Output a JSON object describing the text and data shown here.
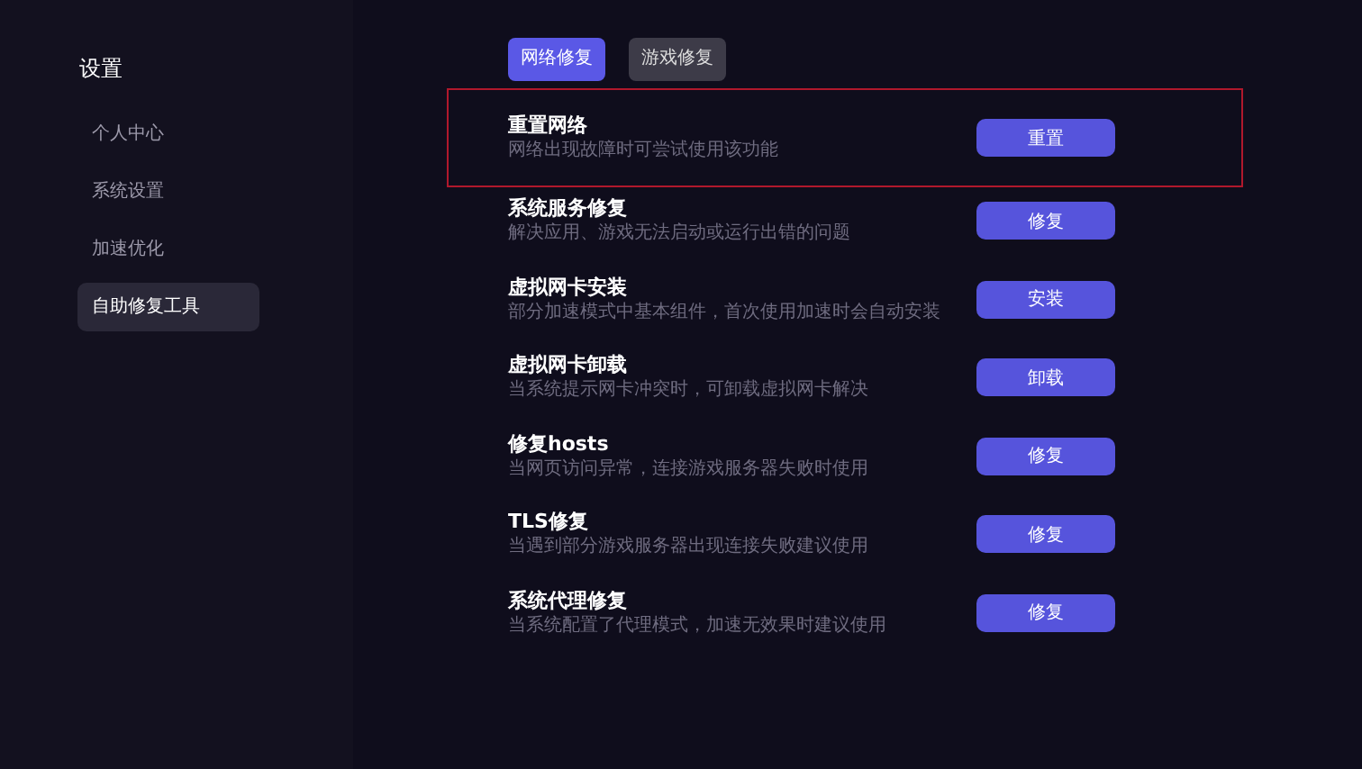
{
  "sidebar": {
    "title": "设置",
    "items": [
      {
        "label": "个人中心",
        "selected": false
      },
      {
        "label": "系统设置",
        "selected": false
      },
      {
        "label": "加速优化",
        "selected": false
      },
      {
        "label": "自助修复工具",
        "selected": true
      }
    ]
  },
  "tabs": [
    {
      "label": "网络修复",
      "selected": true
    },
    {
      "label": "游戏修复",
      "selected": false
    }
  ],
  "rows": [
    {
      "title": "重置网络",
      "description": "网络出现故障时可尝试使用该功能",
      "button": "重置",
      "highlighted": true
    },
    {
      "title": "系统服务修复",
      "description": "解决应用、游戏无法启动或运行出错的问题",
      "button": "修复",
      "highlighted": false
    },
    {
      "title": "虚拟网卡安装",
      "description": "部分加速模式中基本组件，首次使用加速时会自动安装",
      "button": "安装",
      "highlighted": false
    },
    {
      "title": "虚拟网卡卸载",
      "description": "当系统提示网卡冲突时，可卸载虚拟网卡解决",
      "button": "卸载",
      "highlighted": false
    },
    {
      "title": "修复hosts",
      "description": "当网页访问异常，连接游戏服务器失败时使用",
      "button": "修复",
      "highlighted": false
    },
    {
      "title": "TLS修复",
      "description": "当遇到部分游戏服务器出现连接失败建议使用",
      "button": "修复",
      "highlighted": false
    },
    {
      "title": "系统代理修复",
      "description": "当系统配置了代理模式，加速无效果时建议使用",
      "button": "修复",
      "highlighted": false
    }
  ]
}
